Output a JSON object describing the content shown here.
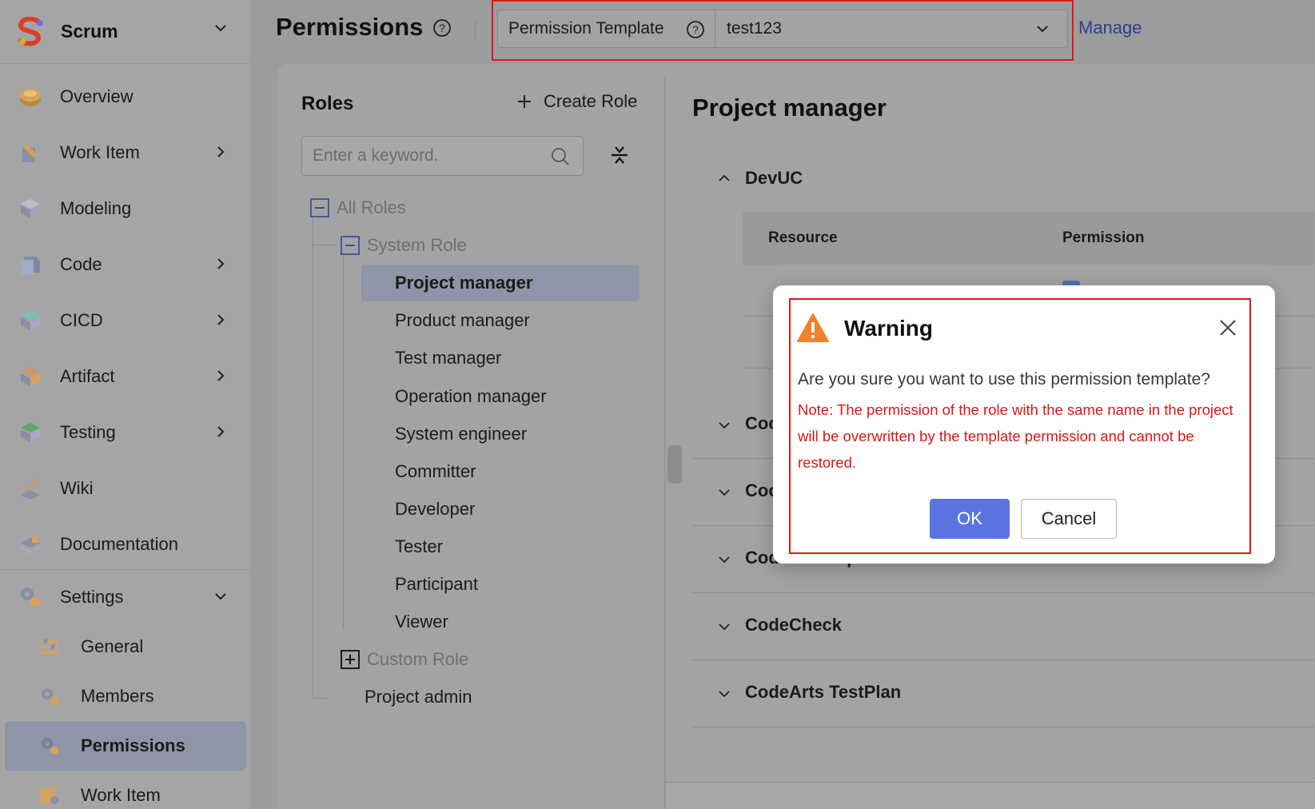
{
  "project": {
    "name": "Scrum"
  },
  "sidebar": {
    "items": [
      {
        "label": "Overview",
        "icon": "overview-icon"
      },
      {
        "label": "Work Item",
        "icon": "work-item-icon"
      },
      {
        "label": "Modeling",
        "icon": "modeling-icon"
      },
      {
        "label": "Code",
        "icon": "code-icon"
      },
      {
        "label": "CICD",
        "icon": "cicd-icon"
      },
      {
        "label": "Artifact",
        "icon": "artifact-icon"
      },
      {
        "label": "Testing",
        "icon": "testing-icon"
      },
      {
        "label": "Wiki",
        "icon": "wiki-icon"
      },
      {
        "label": "Documentation",
        "icon": "documentation-icon"
      },
      {
        "label": "Settings",
        "icon": "settings-icon"
      }
    ],
    "settings_sub": [
      {
        "label": "General",
        "icon": "general-icon"
      },
      {
        "label": "Members",
        "icon": "members-icon"
      },
      {
        "label": "Permissions",
        "icon": "permissions-icon",
        "active": true
      },
      {
        "label": "Work Item",
        "icon": "work-item-settings-icon"
      }
    ]
  },
  "header": {
    "title": "Permissions",
    "template_label": "Permission Template",
    "template_value": "test123",
    "manage_link": "Manage"
  },
  "roles": {
    "title": "Roles",
    "create_label": "Create Role",
    "search_placeholder": "Enter a keyword.",
    "all_roles": "All Roles",
    "system_role": "System Role",
    "system_items": [
      "Project manager",
      "Product manager",
      "Test manager",
      "Operation manager",
      "System engineer",
      "Committer",
      "Developer",
      "Tester",
      "Participant",
      "Viewer"
    ],
    "custom_role": "Custom Role",
    "project_admin": "Project admin"
  },
  "detail": {
    "title": "Project manager",
    "devuc": "DevUC",
    "col_resource": "Resource",
    "col_permission": "Permission",
    "sections": [
      "Coc",
      "Coc",
      "CodeArtsRepo",
      "CodeCheck",
      "CodeArts TestPlan"
    ]
  },
  "modal": {
    "title": "Warning",
    "message": "Are you sure you want to use this permission template?",
    "note": "Note: The permission of the role with the same name in the project will be overwritten by the template permission and cannot be restored.",
    "ok": "OK",
    "cancel": "Cancel"
  },
  "colors": {
    "primary": "#5b73e2",
    "warning_orange": "#f0812e",
    "highlight_red": "#d71a1a",
    "note_red": "#e01414"
  }
}
